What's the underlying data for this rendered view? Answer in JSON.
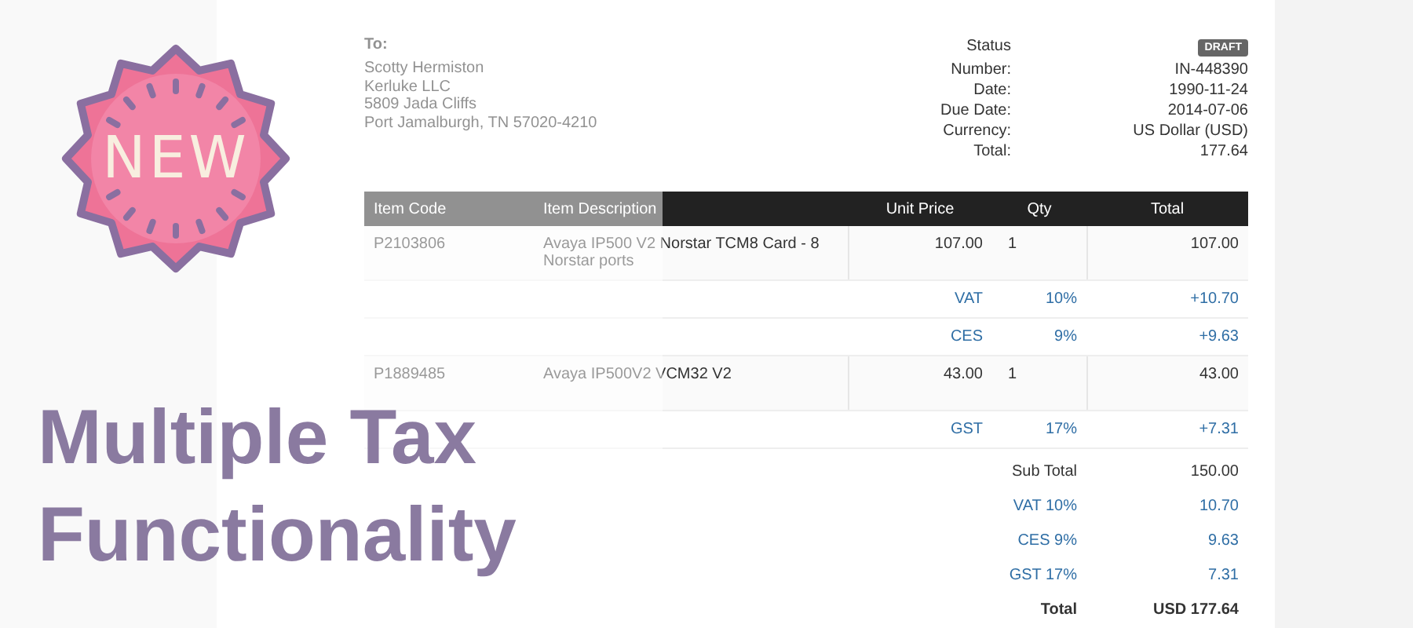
{
  "badge": {
    "label": "NEW"
  },
  "headline": [
    "Multiple Tax",
    "Functionality"
  ],
  "invoice": {
    "to_label": "To:",
    "recipient": [
      "Scotty Hermiston",
      "Kerluke LLC",
      "5809 Jada Cliffs",
      "Port Jamalburgh, TN 57020-4210"
    ],
    "details": [
      {
        "label": "Status",
        "value": "DRAFT",
        "kind": "badge"
      },
      {
        "label": "Number:",
        "value": "IN-448390",
        "kind": "text"
      },
      {
        "label": "Date:",
        "value": "1990-11-24",
        "kind": "text"
      },
      {
        "label": "Due Date:",
        "value": "2014-07-06",
        "kind": "text"
      },
      {
        "label": "Currency:",
        "value": "US Dollar (USD)",
        "kind": "text"
      },
      {
        "label": "Total:",
        "value": "177.64",
        "kind": "text"
      }
    ],
    "table": {
      "columns": [
        "Item Code",
        "Item Description",
        "Unit Price",
        "Qty",
        "Total"
      ],
      "rows": [
        {
          "kind": "item",
          "code": "P2103806",
          "description": "Avaya IP500 V2 Norstar TCM8 Card - 8 Norstar ports",
          "unit_price": "107.00",
          "qty": "1",
          "total": "107.00"
        },
        {
          "kind": "tax",
          "name": "VAT",
          "rate": "10%",
          "amount": "+10.70"
        },
        {
          "kind": "tax",
          "name": "CES",
          "rate": "9%",
          "amount": "+9.63"
        },
        {
          "kind": "item",
          "code": "P1889485",
          "description": "Avaya IP500V2 VCM32 V2",
          "unit_price": "43.00",
          "qty": "1",
          "total": "43.00"
        },
        {
          "kind": "tax",
          "name": "GST",
          "rate": "17%",
          "amount": "+7.31"
        }
      ]
    },
    "totals": [
      {
        "label": "Sub Total",
        "value": "150.00",
        "kind": "plain"
      },
      {
        "label": "VAT 10%",
        "value": "10.70",
        "kind": "tax"
      },
      {
        "label": "CES 9%",
        "value": "9.63",
        "kind": "tax"
      },
      {
        "label": "GST 17%",
        "value": "7.31",
        "kind": "tax"
      },
      {
        "label": "Total",
        "value": "USD 177.64",
        "kind": "grand"
      }
    ]
  }
}
